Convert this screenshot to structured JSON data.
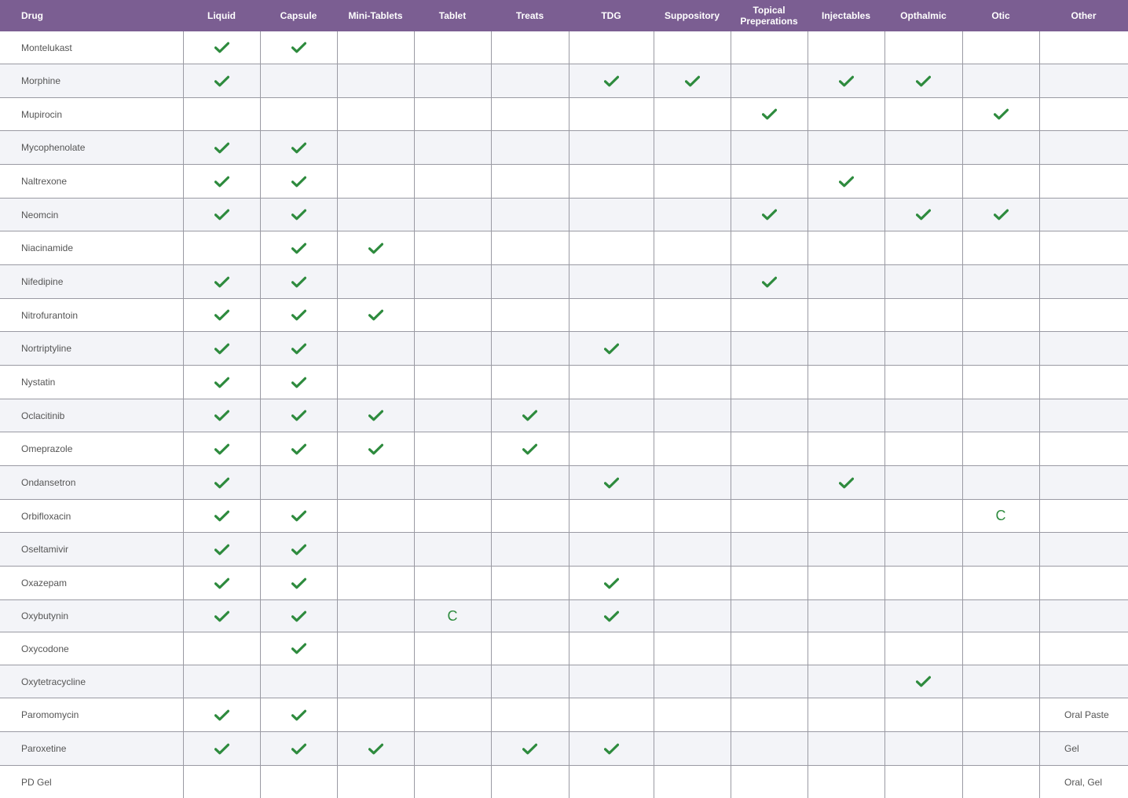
{
  "table": {
    "headers": [
      "Drug",
      "Liquid",
      "Capsule",
      "Mini-Tablets",
      "Tablet",
      "Treats",
      "TDG",
      "Suppository",
      "Topical Preperations",
      "Injectables",
      "Opthalmic",
      "Otic",
      "Other"
    ],
    "rows": [
      {
        "drug": "Montelukast",
        "marks": [
          "check",
          "check",
          "",
          "",
          "",
          "",
          "",
          "",
          "",
          "",
          ""
        ],
        "other": ""
      },
      {
        "drug": "Morphine",
        "marks": [
          "check",
          "",
          "",
          "",
          "",
          "check",
          "check",
          "",
          "check",
          "check",
          ""
        ],
        "other": ""
      },
      {
        "drug": "Mupirocin",
        "marks": [
          "",
          "",
          "",
          "",
          "",
          "",
          "",
          "check",
          "",
          "",
          "check"
        ],
        "other": ""
      },
      {
        "drug": "Mycophenolate",
        "marks": [
          "check",
          "check",
          "",
          "",
          "",
          "",
          "",
          "",
          "",
          "",
          ""
        ],
        "other": ""
      },
      {
        "drug": "Naltrexone",
        "marks": [
          "check",
          "check",
          "",
          "",
          "",
          "",
          "",
          "",
          "check",
          "",
          ""
        ],
        "other": ""
      },
      {
        "drug": "Neomcin",
        "marks": [
          "check",
          "check",
          "",
          "",
          "",
          "",
          "",
          "check",
          "",
          "check",
          "check"
        ],
        "other": ""
      },
      {
        "drug": "Niacinamide",
        "marks": [
          "",
          "check",
          "check",
          "",
          "",
          "",
          "",
          "",
          "",
          "",
          ""
        ],
        "other": ""
      },
      {
        "drug": "Nifedipine",
        "marks": [
          "check",
          "check",
          "",
          "",
          "",
          "",
          "",
          "check",
          "",
          "",
          ""
        ],
        "other": ""
      },
      {
        "drug": "Nitrofurantoin",
        "marks": [
          "check",
          "check",
          "check",
          "",
          "",
          "",
          "",
          "",
          "",
          "",
          ""
        ],
        "other": ""
      },
      {
        "drug": "Nortriptyline",
        "marks": [
          "check",
          "check",
          "",
          "",
          "",
          "check",
          "",
          "",
          "",
          "",
          ""
        ],
        "other": ""
      },
      {
        "drug": "Nystatin",
        "marks": [
          "check",
          "check",
          "",
          "",
          "",
          "",
          "",
          "",
          "",
          "",
          ""
        ],
        "other": ""
      },
      {
        "drug": "Oclacitinib",
        "marks": [
          "check",
          "check",
          "check",
          "",
          "check",
          "",
          "",
          "",
          "",
          "",
          ""
        ],
        "other": ""
      },
      {
        "drug": "Omeprazole",
        "marks": [
          "check",
          "check",
          "check",
          "",
          "check",
          "",
          "",
          "",
          "",
          "",
          ""
        ],
        "other": ""
      },
      {
        "drug": "Ondansetron",
        "marks": [
          "check",
          "",
          "",
          "",
          "",
          "check",
          "",
          "",
          "check",
          "",
          ""
        ],
        "other": ""
      },
      {
        "drug": "Orbifloxacin",
        "marks": [
          "check",
          "check",
          "",
          "",
          "",
          "",
          "",
          "",
          "",
          "",
          "C"
        ],
        "other": ""
      },
      {
        "drug": "Oseltamivir",
        "marks": [
          "check",
          "check",
          "",
          "",
          "",
          "",
          "",
          "",
          "",
          "",
          ""
        ],
        "other": ""
      },
      {
        "drug": "Oxazepam",
        "marks": [
          "check",
          "check",
          "",
          "",
          "",
          "check",
          "",
          "",
          "",
          "",
          ""
        ],
        "other": ""
      },
      {
        "drug": "Oxybutynin",
        "marks": [
          "check",
          "check",
          "",
          "C",
          "",
          "check",
          "",
          "",
          "",
          "",
          ""
        ],
        "other": ""
      },
      {
        "drug": "Oxycodone",
        "marks": [
          "",
          "check",
          "",
          "",
          "",
          "",
          "",
          "",
          "",
          "",
          ""
        ],
        "other": ""
      },
      {
        "drug": "Oxytetracycline",
        "marks": [
          "",
          "",
          "",
          "",
          "",
          "",
          "",
          "",
          "",
          "check",
          ""
        ],
        "other": ""
      },
      {
        "drug": "Paromomycin",
        "marks": [
          "check",
          "check",
          "",
          "",
          "",
          "",
          "",
          "",
          "",
          "",
          ""
        ],
        "other": "Oral Paste"
      },
      {
        "drug": "Paroxetine",
        "marks": [
          "check",
          "check",
          "check",
          "",
          "check",
          "check",
          "",
          "",
          "",
          "",
          ""
        ],
        "other": "Gel"
      },
      {
        "drug": "PD Gel",
        "marks": [
          "",
          "",
          "",
          "",
          "",
          "",
          "",
          "",
          "",
          "",
          ""
        ],
        "other": "Oral, Gel"
      }
    ]
  },
  "colors": {
    "header_bg": "#7b5e92",
    "check": "#2e8b3e",
    "grid_line": "#9a9aa3",
    "alt_row": "#f3f4f8"
  },
  "icons": {
    "check": "check-icon"
  }
}
